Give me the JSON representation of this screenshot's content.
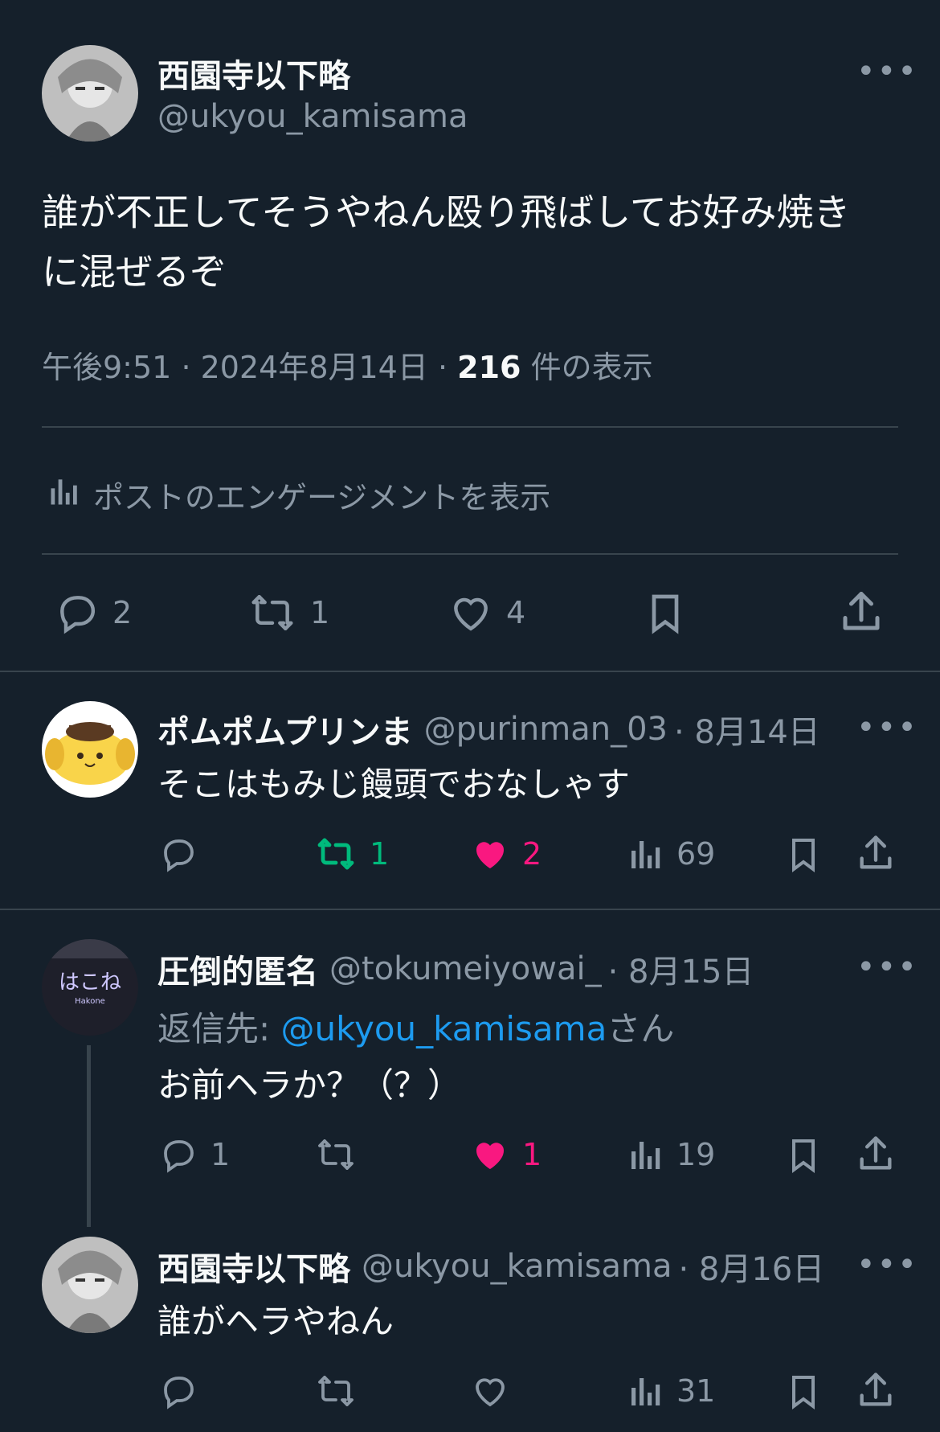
{
  "main_post": {
    "display_name": "西園寺以下略",
    "handle": "@ukyou_kamisama",
    "text_line1": "誰が不正してそうやねん殴り飛ばしてお好み焼き",
    "text_line2": "に混ぜるぞ",
    "time": "午後9:51",
    "sep": "·",
    "date": "2024年8月14日",
    "views_count": "216",
    "views_label": "件の表示",
    "engagement_link": "ポストのエンゲージメントを表示",
    "replies": "2",
    "reposts": "1",
    "likes": "4",
    "more": "•••"
  },
  "reply1": {
    "display_name": "ポムポムプリンま",
    "handle": "@purinman_03",
    "date": "· 8月14日",
    "text": "そこはもみじ饅頭でおなしゃす",
    "replies": "",
    "reposts": "1",
    "likes": "2",
    "views": "69",
    "more": "•••"
  },
  "reply2": {
    "display_name": "圧倒的匿名",
    "handle": "@tokumeiyowai_",
    "date": "· 8月15日",
    "replying_prefix": "返信先: ",
    "replying_handle": "@ukyou_kamisama",
    "replying_suffix": "さん",
    "text": "お前ヘラか？（？）",
    "avatar_text": "はこね",
    "avatar_subtext": "Hakone",
    "replies": "1",
    "reposts": "",
    "likes": "1",
    "views": "19",
    "more": "•••"
  },
  "reply3": {
    "display_name": "西園寺以下略",
    "handle": "@ukyou_kamisama",
    "date": "· 8月16日",
    "text": "誰がヘラやねん",
    "replies": "",
    "reposts": "",
    "likes": "",
    "views": "31",
    "more": "•••"
  },
  "colors": {
    "background": "#15202b",
    "text": "#f7f9f9",
    "muted": "#8b98a5",
    "link": "#1d9bf0",
    "repost_active": "#00ba7c",
    "like_active": "#f91880",
    "divider": "#38444d"
  },
  "icons": [
    "reply-icon",
    "repost-icon",
    "like-icon",
    "bookmark-icon",
    "share-icon",
    "analytics-icon",
    "more-icon"
  ]
}
